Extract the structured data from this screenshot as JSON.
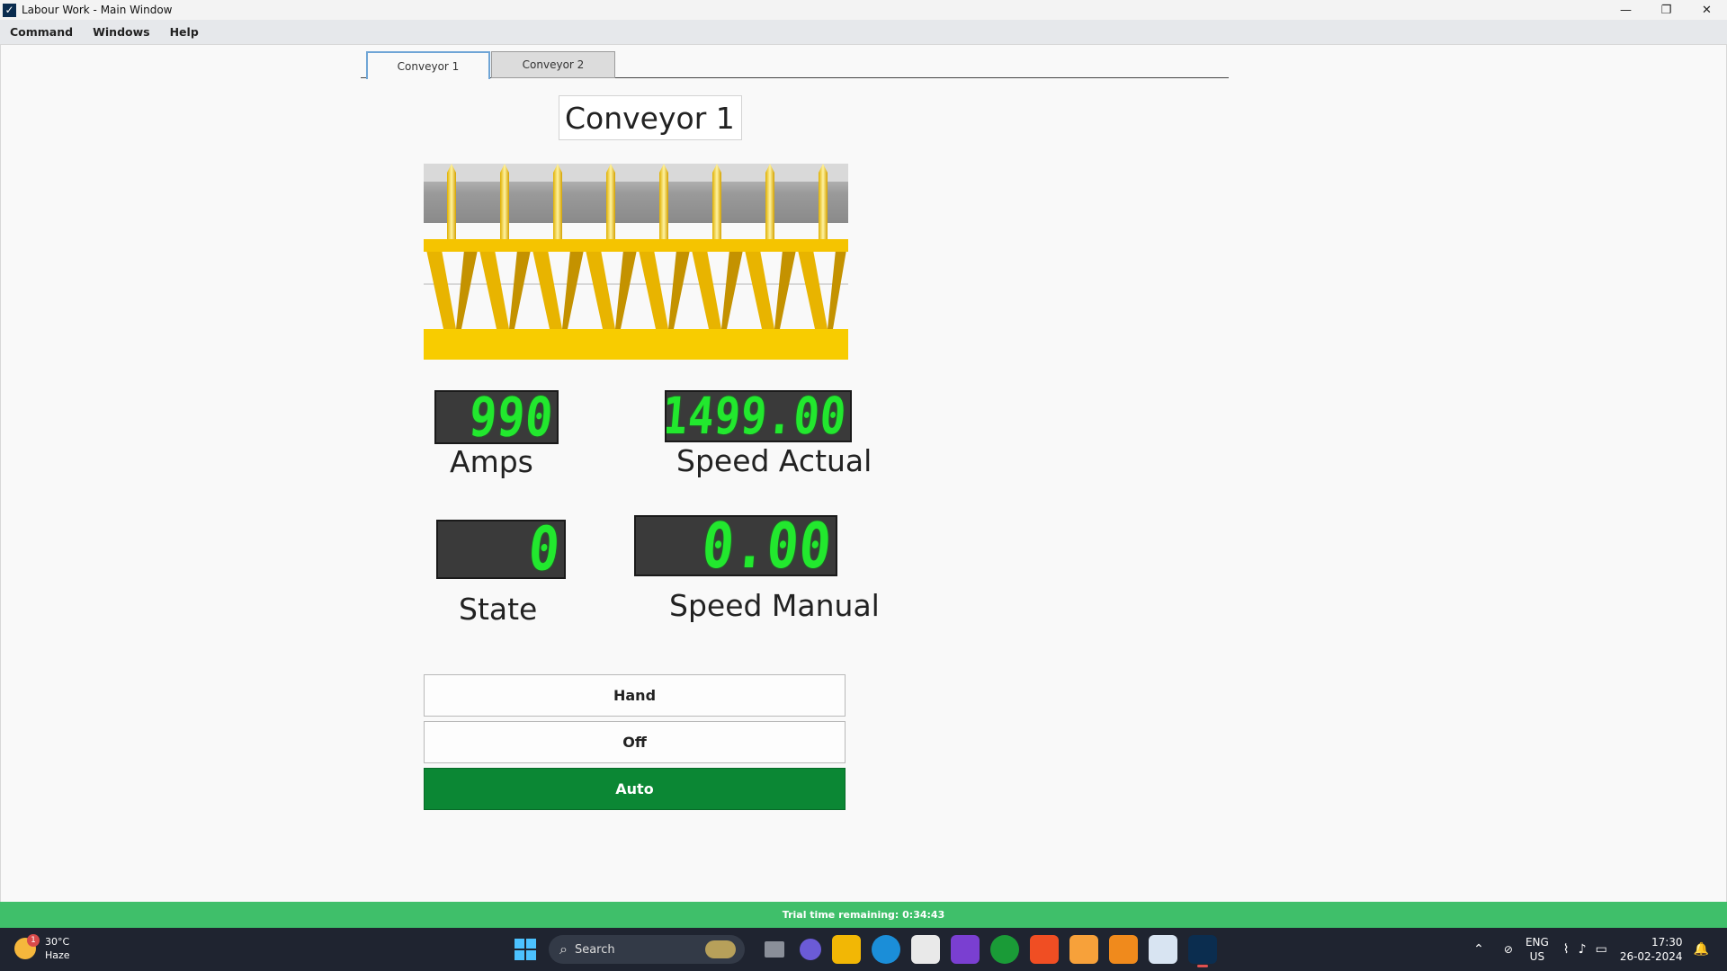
{
  "window": {
    "title": "Labour Work - Main Window",
    "app_icon_glyph": "✓",
    "controls": {
      "minimize": "—",
      "restore": "❐",
      "close": "✕"
    }
  },
  "menu": {
    "items": [
      "Command",
      "Windows",
      "Help"
    ]
  },
  "tabs": [
    {
      "label": "Conveyor 1",
      "active": true
    },
    {
      "label": "Conveyor 2",
      "active": false
    }
  ],
  "panel": {
    "title": "Conveyor 1",
    "amps": {
      "value": "990",
      "label": "Amps"
    },
    "speed_actual": {
      "value": "1499.00",
      "label": "Speed Actual"
    },
    "state": {
      "value": "0",
      "label": "State"
    },
    "speed_manual": {
      "value": "0.00",
      "label": "Speed Manual"
    }
  },
  "mode_buttons": {
    "hand": "Hand",
    "off": "Off",
    "auto": "Auto",
    "selected": "auto",
    "selected_color": "#0b8734"
  },
  "trial": {
    "text": "Trial time remaining: 0:34:43"
  },
  "taskbar": {
    "weather": {
      "temp": "30°C",
      "condition": "Haze",
      "badge": "1"
    },
    "search_placeholder": "Search",
    "tray": {
      "lang_line1": "ENG",
      "lang_line2": "US",
      "time": "17:30",
      "date": "26-02-2024"
    }
  },
  "colors": {
    "lcd_digit": "#22e82e",
    "lcd_background": "#3a3a3a",
    "conveyor_gold": "#f5c400",
    "trial_banner": "#3fbf6a"
  }
}
